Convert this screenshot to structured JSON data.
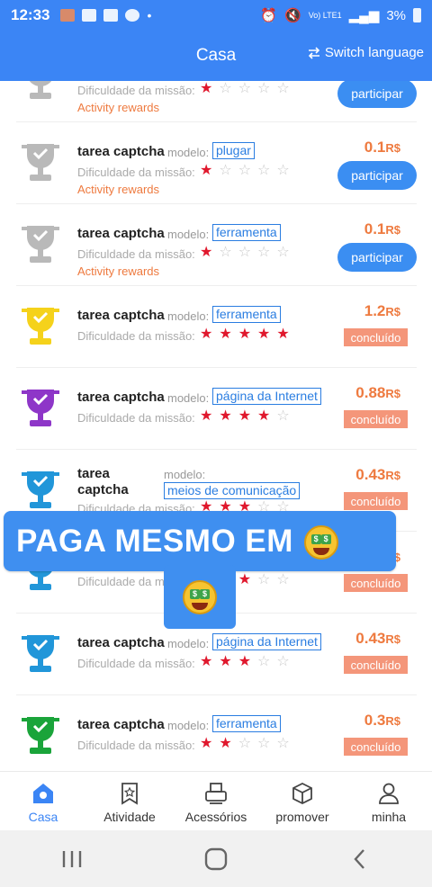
{
  "status_bar": {
    "time": "12:33",
    "network": "Vo) LTE1",
    "battery": "3%"
  },
  "header": {
    "title": "Casa",
    "switch_language": "Switch language",
    "switch_icon": "swap-icon"
  },
  "tasks": [
    {
      "name": "",
      "modelo": "",
      "tag": "",
      "difficulty_label": "Dificuldade da missão:",
      "stars": 1,
      "reward_note": "Activity rewards",
      "price": "",
      "currency": "",
      "status": "participar",
      "trophy_color": "#b9b9b9"
    },
    {
      "name": "tarea captcha",
      "modelo": "modelo:",
      "tag": "plugar",
      "difficulty_label": "Dificuldade da missão:",
      "stars": 1,
      "reward_note": "Activity rewards",
      "price": "0.1",
      "currency": "R$",
      "status": "participar",
      "trophy_color": "#b9b9b9"
    },
    {
      "name": "tarea captcha",
      "modelo": "modelo:",
      "tag": "ferramenta",
      "difficulty_label": "Dificuldade da missão:",
      "stars": 1,
      "reward_note": "Activity rewards",
      "price": "0.1",
      "currency": "R$",
      "status": "participar",
      "trophy_color": "#b9b9b9"
    },
    {
      "name": "tarea captcha",
      "modelo": "modelo:",
      "tag": "ferramenta",
      "difficulty_label": "Dificuldade da missão:",
      "stars": 5,
      "reward_note": "",
      "price": "1.2",
      "currency": "R$",
      "status": "concluído",
      "trophy_color": "#f5d21b"
    },
    {
      "name": "tarea captcha",
      "modelo": "modelo:",
      "tag": "página da Internet",
      "difficulty_label": "Dificuldade da missão:",
      "stars": 4,
      "reward_note": "",
      "price": "0.88",
      "currency": "R$",
      "status": "concluído",
      "trophy_color": "#8e36c8"
    },
    {
      "name": "tarea captcha",
      "modelo": "modelo:",
      "tag": "meios de comunicação",
      "difficulty_label": "Dificuldade da missão:",
      "stars": 3,
      "reward_note": "",
      "price": "0.43",
      "currency": "R$",
      "status": "concluído",
      "trophy_color": "#2196d9"
    },
    {
      "name": "",
      "modelo": "",
      "tag": "",
      "difficulty_label": "Dificuldade da missão:",
      "stars": 3,
      "reward_note": "",
      "price": "",
      "currency": "$",
      "status": "concluído",
      "trophy_color": "#2196d9"
    },
    {
      "name": "tarea captcha",
      "modelo": "modelo:",
      "tag": "página da Internet",
      "difficulty_label": "Dificuldade da missão:",
      "stars": 3,
      "reward_note": "",
      "price": "0.43",
      "currency": "R$",
      "status": "concluído",
      "trophy_color": "#2196d9"
    },
    {
      "name": "tarea captcha",
      "modelo": "modelo:",
      "tag": "ferramenta",
      "difficulty_label": "Dificuldade da missão:",
      "stars": 2,
      "reward_note": "",
      "price": "0.3",
      "currency": "R$",
      "status": "concluído",
      "trophy_color": "#1aa43a"
    }
  ],
  "overlay": {
    "banner_text": "PAGA MESMO EM",
    "emoji": "money-mouth-face-emoji"
  },
  "tabbar": [
    {
      "label": "Casa",
      "icon": "home-icon",
      "active": true
    },
    {
      "label": "Atividade",
      "icon": "bookmark-star-icon",
      "active": false
    },
    {
      "label": "Acessórios",
      "icon": "printer-icon",
      "active": false
    },
    {
      "label": "promover",
      "icon": "cube-icon",
      "active": false
    },
    {
      "label": "minha",
      "icon": "user-icon",
      "active": false
    }
  ],
  "navbar": [
    "recent-apps-icon",
    "home-nav-icon",
    "back-icon"
  ]
}
